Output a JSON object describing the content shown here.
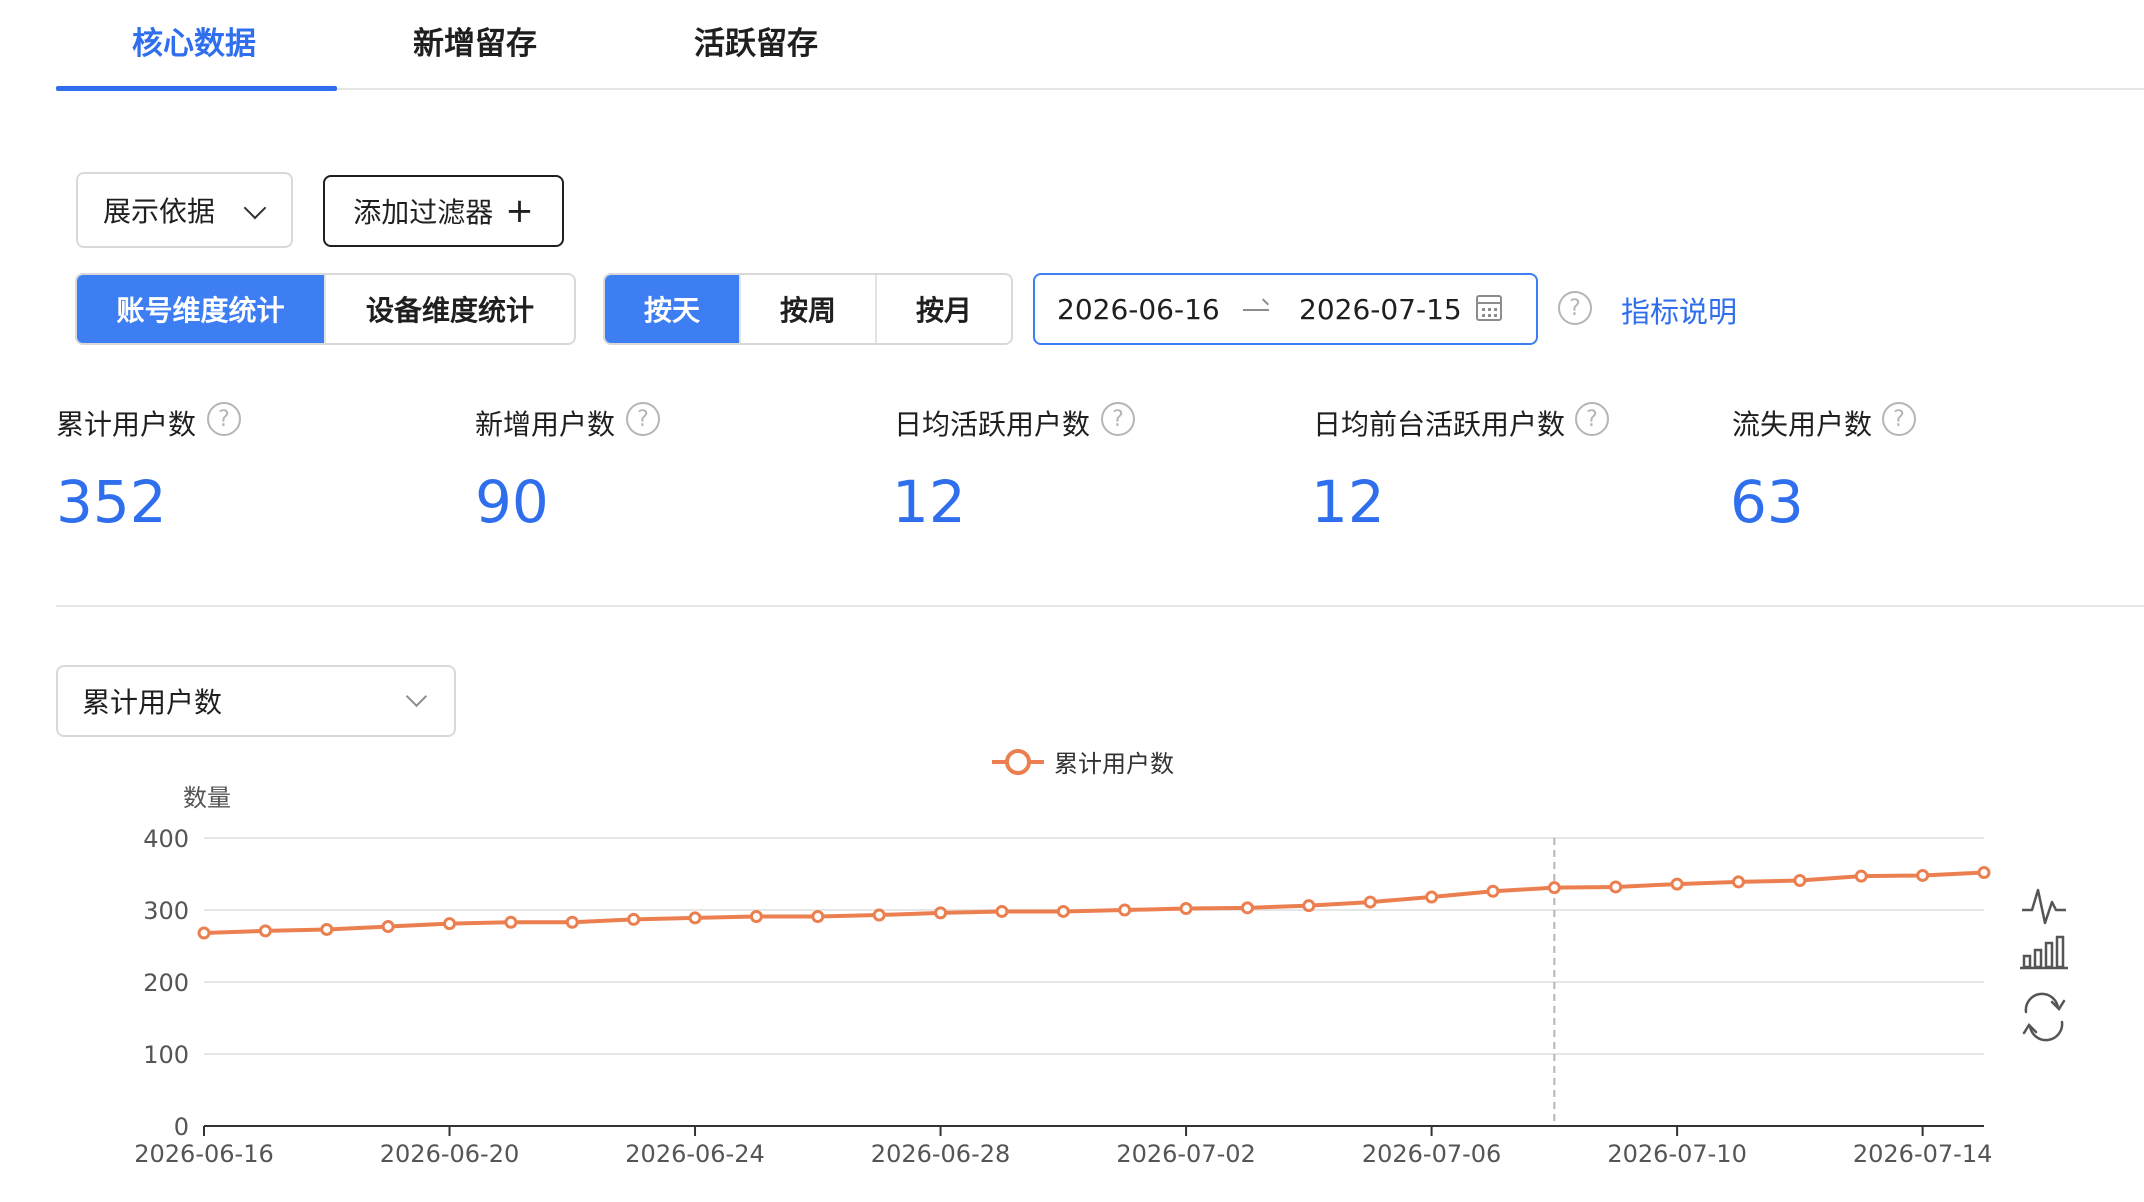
{
  "tabs": [
    {
      "label": "核心数据",
      "active": true
    },
    {
      "label": "新增留存",
      "active": false
    },
    {
      "label": "活跃留存",
      "active": false
    }
  ],
  "toolbar": {
    "basis_label": "展示依据",
    "filter_label": "添加过滤器",
    "filter_plus": "+"
  },
  "dimension": {
    "options": [
      "账号维度统计",
      "设备维度统计"
    ],
    "selected": "账号维度统计"
  },
  "granularity": {
    "options": [
      "按天",
      "按周",
      "按月"
    ],
    "selected": "按天"
  },
  "date_range": {
    "start": "2026-06-16",
    "end": "2026-07-15"
  },
  "metrics_link": "指标说明",
  "help_icon_text": "?",
  "kpis": [
    {
      "label": "累计用户数",
      "value": "352"
    },
    {
      "label": "新增用户数",
      "value": "90"
    },
    {
      "label": "日均活跃用户数",
      "value": "12"
    },
    {
      "label": "日均前台活跃用户数",
      "value": "12"
    },
    {
      "label": "流失用户数",
      "value": "63"
    }
  ],
  "metric_select": {
    "value": "累计用户数"
  },
  "colors": {
    "accent": "#2f6fed",
    "series": "#eb7f4f",
    "grid": "#e6e6e6"
  },
  "chart_data": {
    "type": "line",
    "ylabel": "数量",
    "ylim": [
      0,
      400
    ],
    "yticks": [
      "0",
      "100",
      "200",
      "300",
      "400"
    ],
    "xtick_labels": [
      "2026-06-16",
      "2026-06-20",
      "2026-06-24",
      "2026-06-28",
      "2026-07-02",
      "2026-07-06",
      "2026-07-10",
      "2026-07-14"
    ],
    "legend": "top-center",
    "grid": true,
    "hover_date": "2026-07-08",
    "series": [
      {
        "name": "累计用户数",
        "x": [
          "2026-06-16",
          "2026-06-17",
          "2026-06-18",
          "2026-06-19",
          "2026-06-20",
          "2026-06-21",
          "2026-06-22",
          "2026-06-23",
          "2026-06-24",
          "2026-06-25",
          "2026-06-26",
          "2026-06-27",
          "2026-06-28",
          "2026-06-29",
          "2026-06-30",
          "2026-07-01",
          "2026-07-02",
          "2026-07-03",
          "2026-07-04",
          "2026-07-05",
          "2026-07-06",
          "2026-07-07",
          "2026-07-08",
          "2026-07-09",
          "2026-07-10",
          "2026-07-11",
          "2026-07-12",
          "2026-07-13",
          "2026-07-14",
          "2026-07-15"
        ],
        "values": [
          268,
          271,
          273,
          277,
          281,
          283,
          283,
          287,
          289,
          291,
          291,
          293,
          296,
          298,
          298,
          300,
          302,
          303,
          306,
          311,
          318,
          326,
          331,
          332,
          336,
          339,
          341,
          347,
          348,
          352
        ]
      }
    ]
  }
}
